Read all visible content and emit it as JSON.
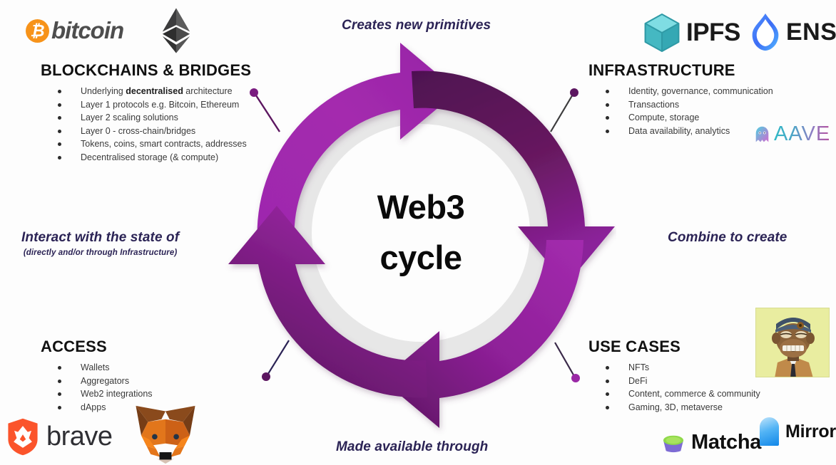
{
  "diagram": {
    "center": {
      "line1": "Web3",
      "line2": "cycle"
    },
    "ring_color_light": "#A42BAE",
    "ring_color_dark": "#561457",
    "ring_inner_ring_color": "#E6E6E6"
  },
  "phrases": {
    "top": "Creates new primitives",
    "right": "Combine to create",
    "bottom": "Made available through",
    "left": "Interact with the state of",
    "left_sub": "(directly and/or through Infrastructure)"
  },
  "quadrants": [
    {
      "id": "blockchains",
      "title": "BLOCKCHAINS & BRIDGES",
      "bullets": [
        {
          "pre": "Underlying ",
          "strong": "decentralised",
          "post": " architecture"
        },
        {
          "pre": "Layer 1 protocols e.g. Bitcoin, Ethereum"
        },
        {
          "pre": "Layer 2 scaling solutions"
        },
        {
          "pre": "Layer 0 - cross-chain/bridges"
        },
        {
          "pre": "Tokens, coins, smart contracts, addresses"
        },
        {
          "pre": "Decentralised storage (& compute)"
        }
      ]
    },
    {
      "id": "infrastructure",
      "title": "INFRASTRUCTURE",
      "bullets": [
        {
          "pre": "Identity, governance, communication"
        },
        {
          "pre": "Transactions"
        },
        {
          "pre": "Compute, storage"
        },
        {
          "pre": "Data availability, analytics"
        }
      ]
    },
    {
      "id": "access",
      "title": "ACCESS",
      "bullets": [
        {
          "pre": "Wallets"
        },
        {
          "pre": "Aggregators"
        },
        {
          "pre": "Web2 integrations"
        },
        {
          "pre": "dApps"
        }
      ]
    },
    {
      "id": "usecases",
      "title": "USE CASES",
      "bullets": [
        {
          "pre": "NFTs"
        },
        {
          "pre": "DeFi"
        },
        {
          "pre": "Content, commerce & community"
        },
        {
          "pre": "Gaming, 3D, metaverse"
        }
      ]
    }
  ],
  "logos": {
    "bitcoin": {
      "symbol": "₿",
      "label": "bitcoin",
      "color": "#F7931A"
    },
    "ethereum": {
      "label": "",
      "color": "#3C3C3D"
    },
    "ipfs": {
      "label": "IPFS",
      "color": "#65C2CB"
    },
    "ens": {
      "label": "ENS",
      "color": "#4E7FFF"
    },
    "aave": {
      "label": "AAVE",
      "color": "#B6509E"
    },
    "brave": {
      "label": "brave",
      "color": "#FB542B"
    },
    "metamask": {
      "label": "",
      "color": "#E2761B"
    },
    "bored_ape": {
      "label": "",
      "color": "#E9EDA0"
    },
    "matcha": {
      "label": "Matcha",
      "color": "#7D6BD4"
    },
    "mirror": {
      "label": "Mirror",
      "color": "#1287E8"
    }
  }
}
